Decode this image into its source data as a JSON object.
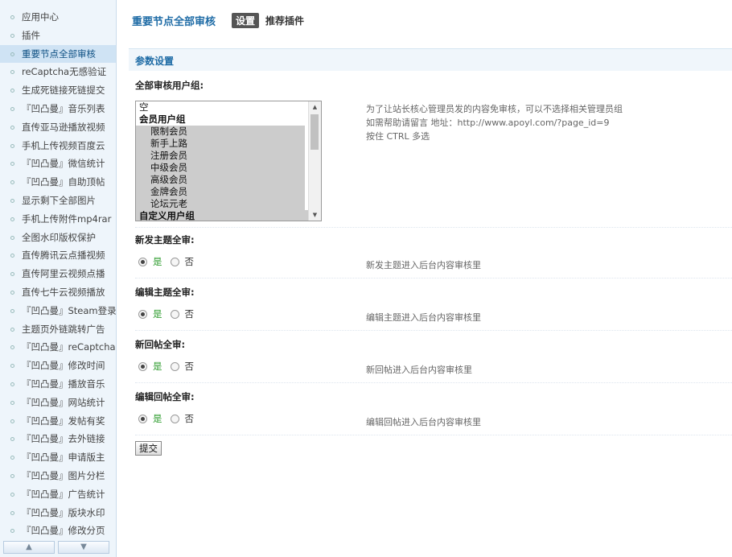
{
  "sidebar": {
    "items": [
      {
        "label": "应用中心"
      },
      {
        "label": "插件"
      },
      {
        "label": "重要节点全部审核",
        "active": true
      },
      {
        "label": "reCaptcha无感验证"
      },
      {
        "label": "生成死链接死链提交"
      },
      {
        "label": "『凹凸曼』音乐列表"
      },
      {
        "label": "直传亚马逊播放视频"
      },
      {
        "label": "手机上传视频百度云"
      },
      {
        "label": "『凹凸曼』微信统计"
      },
      {
        "label": "『凹凸曼』自助顶帖"
      },
      {
        "label": "显示剩下全部图片"
      },
      {
        "label": "手机上传附件mp4rar"
      },
      {
        "label": "全图水印版权保护"
      },
      {
        "label": "直传腾讯云点播视频"
      },
      {
        "label": "直传阿里云视频点播"
      },
      {
        "label": "直传七牛云视频播放"
      },
      {
        "label": "『凹凸曼』Steam登录"
      },
      {
        "label": "主题页外链跳转广告"
      },
      {
        "label": "『凹凸曼』reCaptcha"
      },
      {
        "label": "『凹凸曼』修改时间"
      },
      {
        "label": "『凹凸曼』播放音乐"
      },
      {
        "label": "『凹凸曼』网站统计"
      },
      {
        "label": "『凹凸曼』发帖有奖"
      },
      {
        "label": "『凹凸曼』去外链接"
      },
      {
        "label": "『凹凸曼』申请版主"
      },
      {
        "label": "『凹凸曼』图片分栏"
      },
      {
        "label": "『凹凸曼』广告统计"
      },
      {
        "label": "『凹凸曼』版块水印"
      },
      {
        "label": "『凹凸曼』修改分页"
      }
    ],
    "scroll_up_icon": "arrow-up-icon",
    "scroll_down_icon": "arrow-down-icon"
  },
  "header": {
    "title": "重要节点全部审核",
    "tab_settings": "设置",
    "tab_recommend": "推荐插件"
  },
  "section": {
    "title": "参数设置"
  },
  "group_field": {
    "label": "全部审核用户组:",
    "options": [
      {
        "text": "空",
        "kind": "plain"
      },
      {
        "text": "会员用户组",
        "kind": "group"
      },
      {
        "text": "限制会员",
        "kind": "sel"
      },
      {
        "text": "新手上路",
        "kind": "sel"
      },
      {
        "text": "注册会员",
        "kind": "sel"
      },
      {
        "text": "中级会员",
        "kind": "sel"
      },
      {
        "text": "高级会员",
        "kind": "sel"
      },
      {
        "text": "金牌会员",
        "kind": "sel"
      },
      {
        "text": "论坛元老",
        "kind": "sel"
      },
      {
        "text": "自定义用户组",
        "kind": "group"
      }
    ],
    "hint_line1": "为了让站长核心管理员发的内容免审核，可以不选择相关管理员组",
    "hint_line2": "如需帮助请留言 地址：http://www.apoyl.com/?page_id=9",
    "hint_line3": "按住 CTRL 多选"
  },
  "fields": [
    {
      "label": "新发主题全审:",
      "yes": "是",
      "no": "否",
      "value": "yes",
      "hint": "新发主题进入后台内容审核里"
    },
    {
      "label": "编辑主题全审:",
      "yes": "是",
      "no": "否",
      "value": "yes",
      "hint": "编辑主题进入后台内容审核里"
    },
    {
      "label": "新回帖全审:",
      "yes": "是",
      "no": "否",
      "value": "yes",
      "hint": "新回帖进入后台内容审核里"
    },
    {
      "label": "编辑回帖全审:",
      "yes": "是",
      "no": "否",
      "value": "yes",
      "hint": "编辑回帖进入后台内容审核里"
    }
  ],
  "submit_label": "提交",
  "colors": {
    "accent": "#1f6ca6",
    "sidebar_bg": "#eef5fb",
    "active_item": "#cfe3f4",
    "yes_green": "#2a9a2a"
  }
}
